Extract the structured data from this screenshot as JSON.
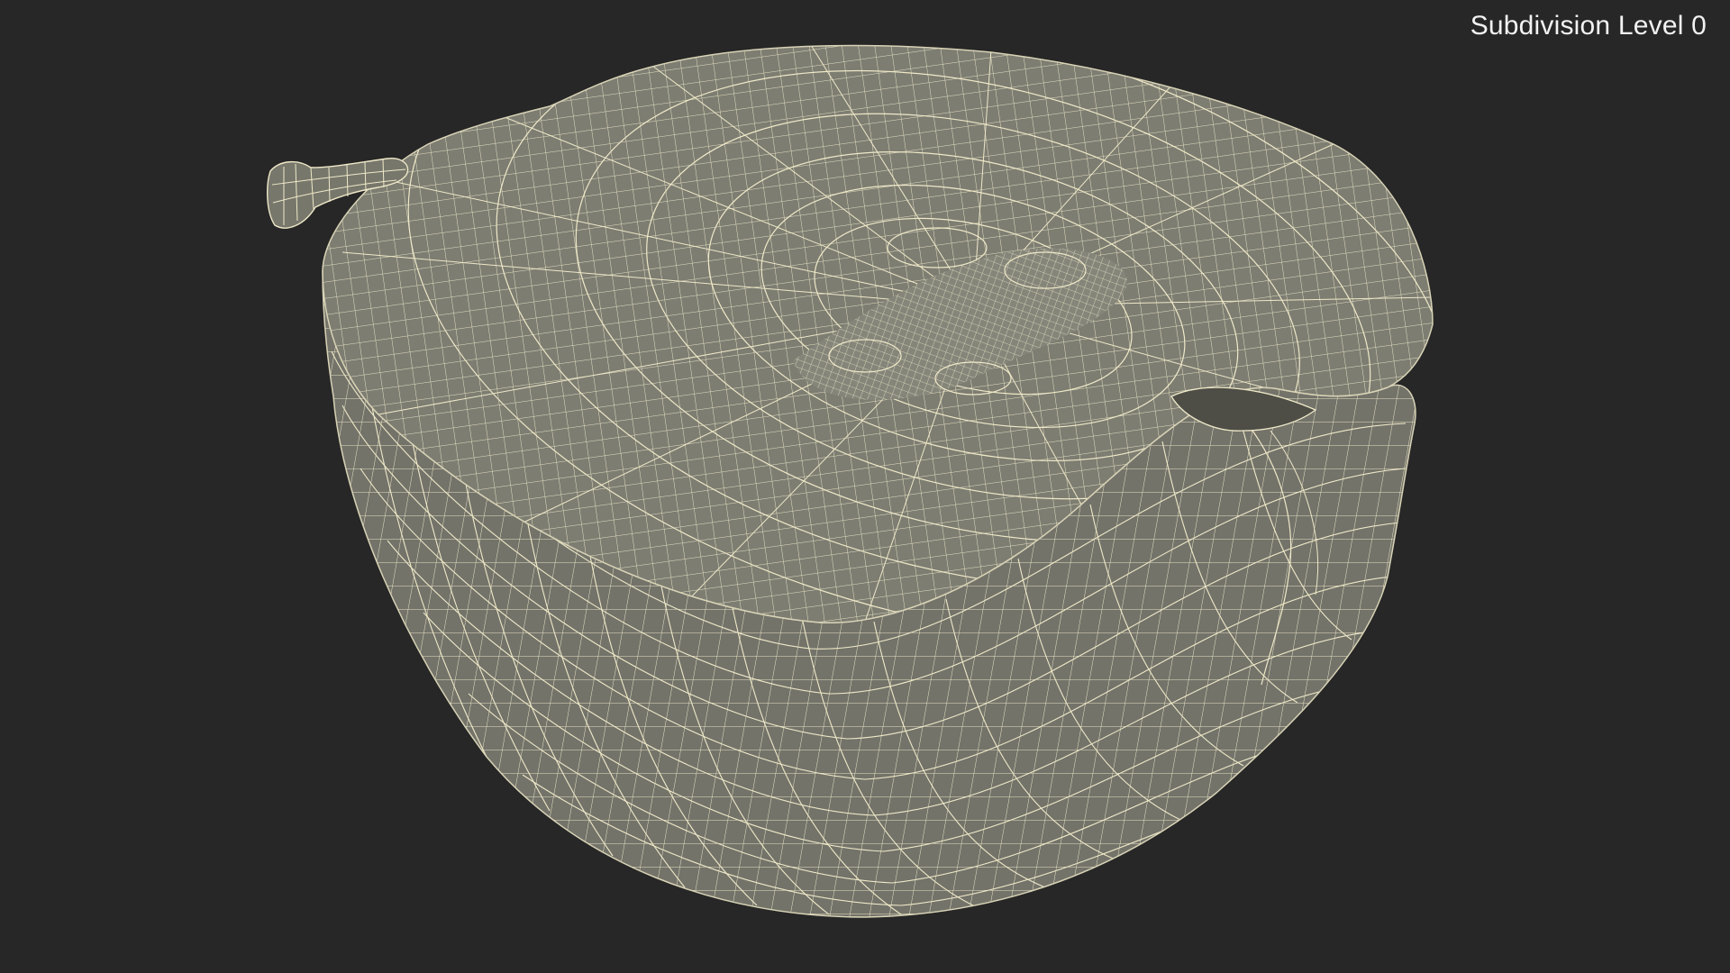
{
  "viewport": {
    "subdivision_label": "Subdivision Level 0",
    "background_color": "#272727"
  },
  "model": {
    "subject": "halved pear wireframe mesh",
    "surface_color": "#7a7a6e",
    "wire_color": "#f0ecd2",
    "stem_icon": "stem-icon"
  }
}
